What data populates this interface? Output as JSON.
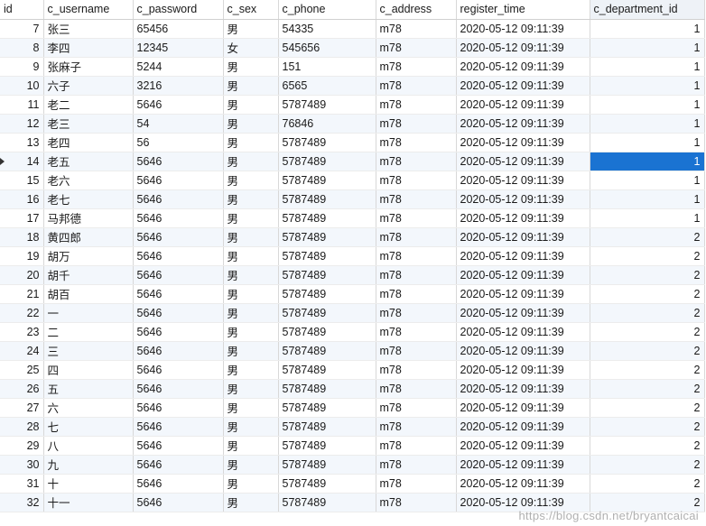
{
  "columns": [
    "id",
    "c_username",
    "c_password",
    "c_sex",
    "c_phone",
    "c_address",
    "register_time",
    "c_department_id"
  ],
  "selected_row_id": "14",
  "rows": [
    [
      "7",
      "张三",
      "65456",
      "男",
      "54335",
      "m78",
      "2020-05-12 09:11:39",
      "1"
    ],
    [
      "8",
      "李四",
      "12345",
      "女",
      "545656",
      "m78",
      "2020-05-12 09:11:39",
      "1"
    ],
    [
      "9",
      "张麻子",
      "5244",
      "男",
      "151",
      "m78",
      "2020-05-12 09:11:39",
      "1"
    ],
    [
      "10",
      "六子",
      "3216",
      "男",
      "6565",
      "m78",
      "2020-05-12 09:11:39",
      "1"
    ],
    [
      "11",
      "老二",
      "5646",
      "男",
      "5787489",
      "m78",
      "2020-05-12 09:11:39",
      "1"
    ],
    [
      "12",
      "老三",
      "54",
      "男",
      "76846",
      "m78",
      "2020-05-12 09:11:39",
      "1"
    ],
    [
      "13",
      "老四",
      "56",
      "男",
      "5787489",
      "m78",
      "2020-05-12 09:11:39",
      "1"
    ],
    [
      "14",
      "老五",
      "5646",
      "男",
      "5787489",
      "m78",
      "2020-05-12 09:11:39",
      "1"
    ],
    [
      "15",
      "老六",
      "5646",
      "男",
      "5787489",
      "m78",
      "2020-05-12 09:11:39",
      "1"
    ],
    [
      "16",
      "老七",
      "5646",
      "男",
      "5787489",
      "m78",
      "2020-05-12 09:11:39",
      "1"
    ],
    [
      "17",
      "马邦德",
      "5646",
      "男",
      "5787489",
      "m78",
      "2020-05-12 09:11:39",
      "1"
    ],
    [
      "18",
      "黄四郎",
      "5646",
      "男",
      "5787489",
      "m78",
      "2020-05-12 09:11:39",
      "2"
    ],
    [
      "19",
      "胡万",
      "5646",
      "男",
      "5787489",
      "m78",
      "2020-05-12 09:11:39",
      "2"
    ],
    [
      "20",
      "胡千",
      "5646",
      "男",
      "5787489",
      "m78",
      "2020-05-12 09:11:39",
      "2"
    ],
    [
      "21",
      "胡百",
      "5646",
      "男",
      "5787489",
      "m78",
      "2020-05-12 09:11:39",
      "2"
    ],
    [
      "22",
      "一",
      "5646",
      "男",
      "5787489",
      "m78",
      "2020-05-12 09:11:39",
      "2"
    ],
    [
      "23",
      "二",
      "5646",
      "男",
      "5787489",
      "m78",
      "2020-05-12 09:11:39",
      "2"
    ],
    [
      "24",
      "三",
      "5646",
      "男",
      "5787489",
      "m78",
      "2020-05-12 09:11:39",
      "2"
    ],
    [
      "25",
      "四",
      "5646",
      "男",
      "5787489",
      "m78",
      "2020-05-12 09:11:39",
      "2"
    ],
    [
      "26",
      "五",
      "5646",
      "男",
      "5787489",
      "m78",
      "2020-05-12 09:11:39",
      "2"
    ],
    [
      "27",
      "六",
      "5646",
      "男",
      "5787489",
      "m78",
      "2020-05-12 09:11:39",
      "2"
    ],
    [
      "28",
      "七",
      "5646",
      "男",
      "5787489",
      "m78",
      "2020-05-12 09:11:39",
      "2"
    ],
    [
      "29",
      "八",
      "5646",
      "男",
      "5787489",
      "m78",
      "2020-05-12 09:11:39",
      "2"
    ],
    [
      "30",
      "九",
      "5646",
      "男",
      "5787489",
      "m78",
      "2020-05-12 09:11:39",
      "2"
    ],
    [
      "31",
      "十",
      "5646",
      "男",
      "5787489",
      "m78",
      "2020-05-12 09:11:39",
      "2"
    ],
    [
      "32",
      "十一",
      "5646",
      "男",
      "5787489",
      "m78",
      "2020-05-12 09:11:39",
      "2"
    ]
  ],
  "watermark": "https://blog.csdn.net/bryantcaicai"
}
